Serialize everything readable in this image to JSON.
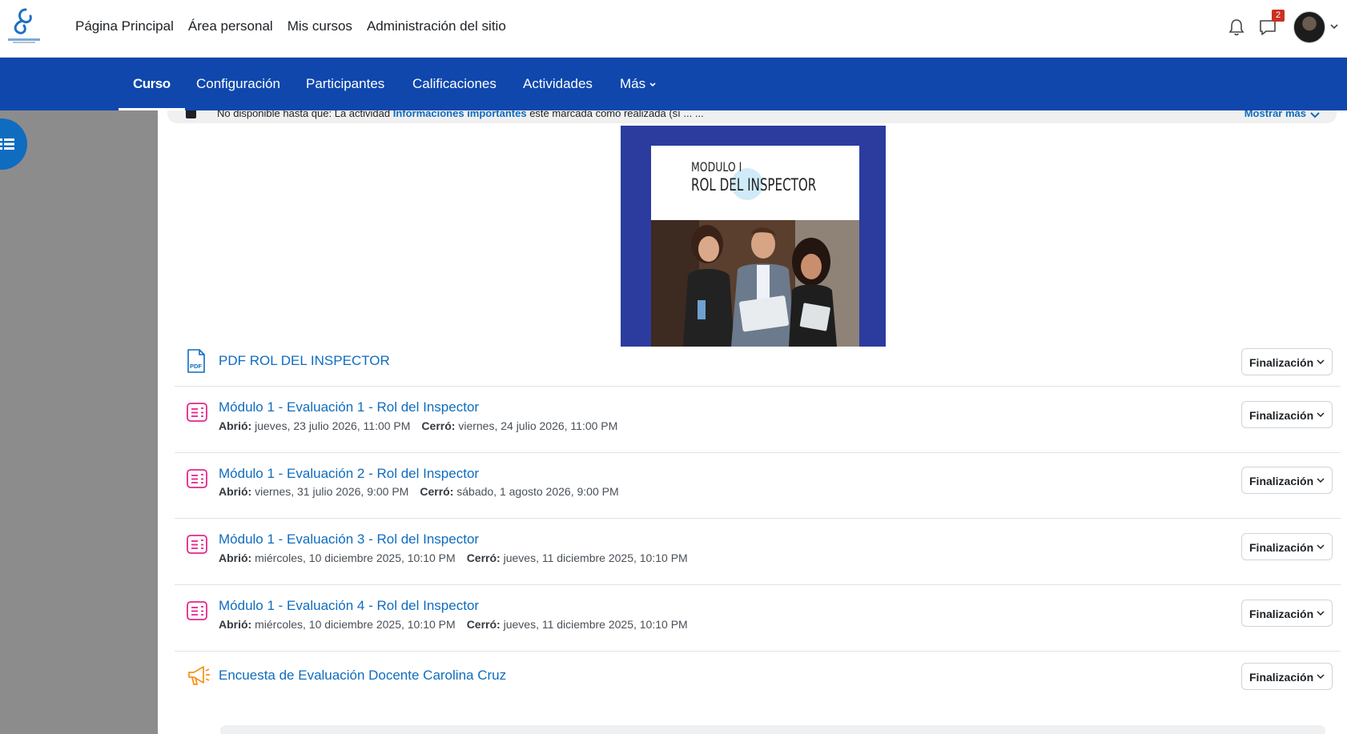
{
  "nav": {
    "items": [
      "Página Principal",
      "Área personal",
      "Mis cursos",
      "Administración del sitio"
    ],
    "notification_count": "2"
  },
  "secondary_nav": {
    "tabs": [
      "Curso",
      "Configuración",
      "Participantes",
      "Calificaciones",
      "Actividades",
      "Más"
    ],
    "active": "Curso"
  },
  "restriction": {
    "prefix": "No disponible hasta que: La actividad ",
    "link": "Informaciones importantes",
    "suffix": " esté marcada como realizada (sí ... ...",
    "more_label": "Mostrar más"
  },
  "cover": {
    "line1": "MODULO I",
    "line2": "ROL DEL INSPECTOR"
  },
  "activities": [
    {
      "type": "pdf",
      "name": "PDF ROL DEL INSPECTOR",
      "button": "Finalización"
    },
    {
      "type": "quiz",
      "name": "Módulo 1 - Evaluación 1 - Rol del Inspector",
      "opened_label": "Abrió:",
      "opened": "jueves, 23 julio 2026, 11:00 PM",
      "closed_label": "Cerró:",
      "closed": "viernes, 24 julio 2026, 11:00 PM",
      "button": "Finalización"
    },
    {
      "type": "quiz",
      "name": "Módulo 1 - Evaluación 2 - Rol del Inspector",
      "opened_label": "Abrió:",
      "opened": "viernes, 31 julio 2026, 9:00 PM",
      "closed_label": "Cerró:",
      "closed": "sábado, 1 agosto 2026, 9:00 PM",
      "button": "Finalización"
    },
    {
      "type": "quiz",
      "name": "Módulo 1 - Evaluación 3 - Rol del Inspector",
      "opened_label": "Abrió:",
      "opened": "miércoles, 10 diciembre 2025, 10:10 PM",
      "closed_label": "Cerró:",
      "closed": "jueves, 11 diciembre 2025, 10:10 PM",
      "button": "Finalización"
    },
    {
      "type": "quiz",
      "name": "Módulo 1 - Evaluación 4 - Rol del Inspector",
      "opened_label": "Abrió:",
      "opened": "miércoles, 10 diciembre 2025, 10:10 PM",
      "closed_label": "Cerró:",
      "closed": "jueves, 11 diciembre 2025, 10:10 PM",
      "button": "Finalización"
    },
    {
      "type": "feedback",
      "name": "Encuesta de Evaluación Docente Carolina Cruz",
      "button": "Finalización"
    }
  ],
  "colors": {
    "brand_blue": "#0f47ad",
    "link_blue": "#0f6cbf",
    "quiz_icon": "#e6268c",
    "feedback_icon": "#f7931e",
    "drawer_gray": "#8c8c8c"
  }
}
